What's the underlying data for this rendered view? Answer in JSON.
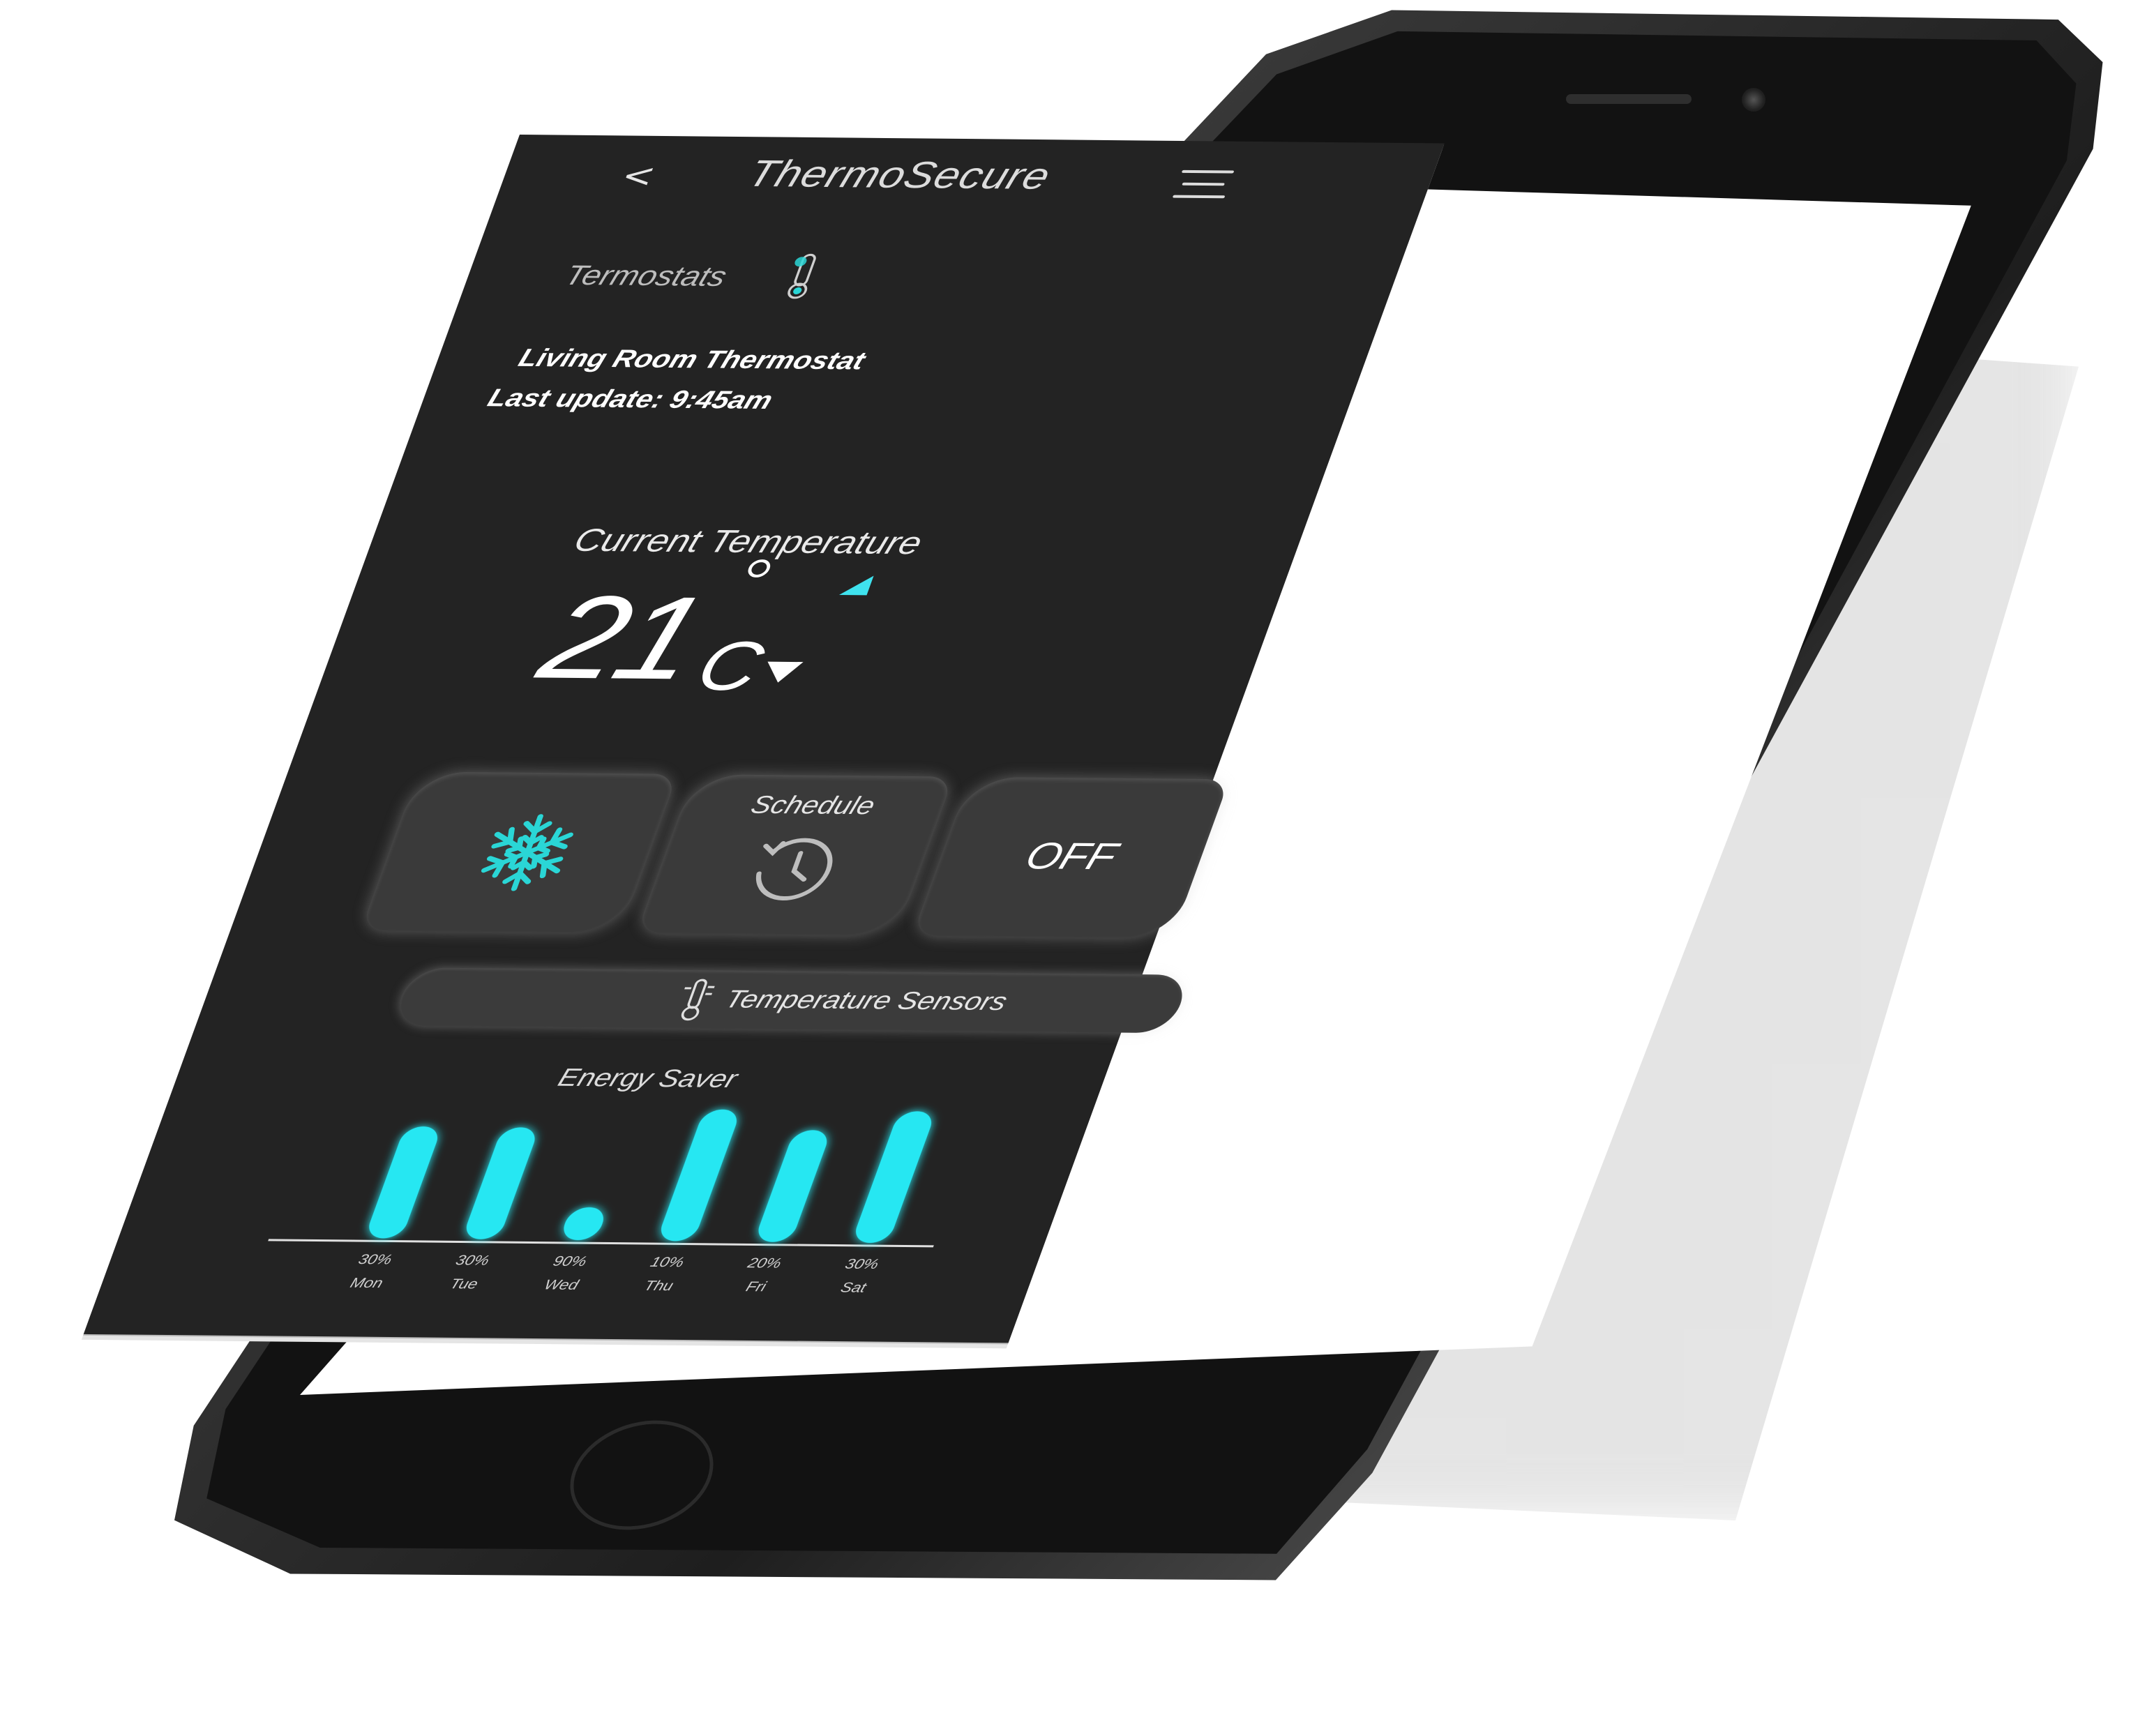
{
  "header": {
    "back_glyph": "<",
    "title": "ThermoSecure",
    "menu_icon": "hamburger-menu-icon"
  },
  "section": {
    "title": "Termostats",
    "icon": "thermometer-icon"
  },
  "device": {
    "name": "Living Room Thermostat",
    "last_update": "Last update: 9:45am"
  },
  "temperature": {
    "label": "Current Temperature",
    "value": "21",
    "unit": "C",
    "up_color": "#3fe2ee",
    "down_color": "#ffffff"
  },
  "modes": {
    "cool_icon": "snowflake-icon",
    "cool_color": "#2ad6d6",
    "schedule_label": "Schedule",
    "schedule_icon": "history-clock-icon",
    "off_label": "OFF"
  },
  "sensors": {
    "label": "Temperature Sensors",
    "icon": "thermometer-icon"
  },
  "energy": {
    "label": "Energy Saver"
  },
  "chart_data": {
    "type": "bar",
    "categories": [
      "Mon",
      "Tue",
      "Wed",
      "Thu",
      "Fri",
      "Sat"
    ],
    "value_labels": [
      "30%",
      "30%",
      "90%",
      "10%",
      "20%",
      "30%"
    ],
    "bar_heights": [
      0.85,
      0.85,
      0.25,
      1.0,
      0.85,
      1.0
    ],
    "bar_color": "#26e7f2",
    "title": "Energy Saver"
  }
}
